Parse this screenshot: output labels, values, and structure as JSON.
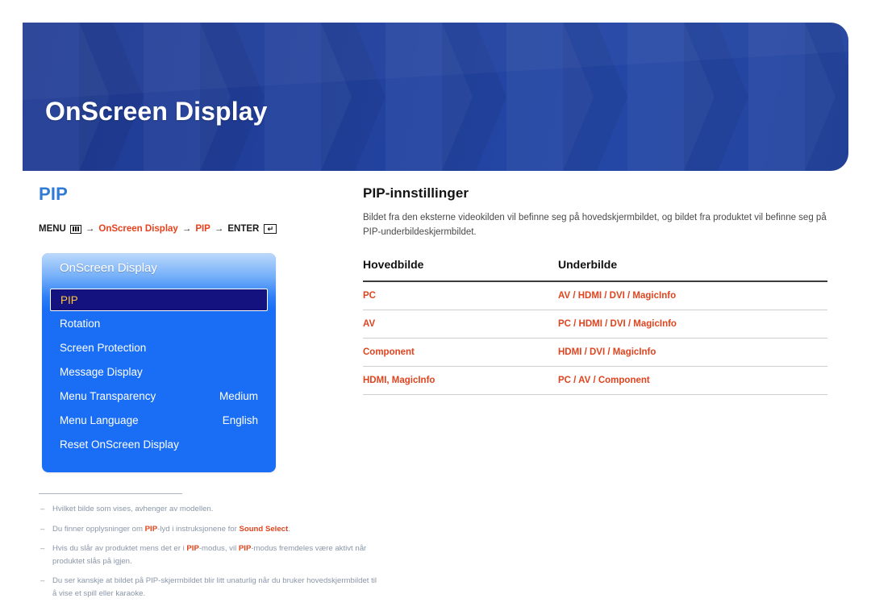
{
  "header": {
    "title": "OnScreen Display",
    "accent_color": "#21409c"
  },
  "left": {
    "section_title": "PIP",
    "breadcrumb": {
      "menu_label": "MENU",
      "menu_icon": "menu-grid-icon",
      "arrow": "→",
      "step1": "OnScreen Display",
      "step2": "PIP",
      "enter_label": "ENTER",
      "enter_icon": "enter-return-icon",
      "enter_glyph": "↵"
    },
    "osd": {
      "panel_title": "OnScreen Display",
      "items": [
        {
          "label": "PIP",
          "value": "",
          "selected": true
        },
        {
          "label": "Rotation",
          "value": "",
          "selected": false
        },
        {
          "label": "Screen Protection",
          "value": "",
          "selected": false
        },
        {
          "label": "Message Display",
          "value": "",
          "selected": false
        },
        {
          "label": "Menu Transparency",
          "value": "Medium",
          "selected": false
        },
        {
          "label": "Menu Language",
          "value": "English",
          "selected": false
        },
        {
          "label": "Reset OnScreen Display",
          "value": "",
          "selected": false
        }
      ],
      "highlight_color": "#ffc742",
      "panel_color": "#1a6ef5"
    }
  },
  "right": {
    "title": "PIP-innstillinger",
    "description": "Bildet fra den eksterne videokilden vil befinne seg på hovedskjermbildet, og bildet fra produktet vil befinne seg på PIP-underbildeskjermbildet.",
    "table": {
      "headers": [
        "Hovedbilde",
        "Underbilde"
      ],
      "rows": [
        [
          "PC",
          "AV / HDMI / DVI / MagicInfo"
        ],
        [
          "AV",
          "PC / HDMI / DVI / MagicInfo"
        ],
        [
          "Component",
          "HDMI / DVI / MagicInfo"
        ],
        [
          "HDMI, MagicInfo",
          "PC / AV / Component"
        ]
      ],
      "value_color": "#e0441f"
    }
  },
  "notes": [
    {
      "parts": [
        {
          "t": "Hvilket bilde som vises, avhenger av modellen.",
          "b": false
        }
      ]
    },
    {
      "parts": [
        {
          "t": "Du finner opplysninger om ",
          "b": false
        },
        {
          "t": "PIP",
          "b": true
        },
        {
          "t": "-lyd i instruksjonene for ",
          "b": false
        },
        {
          "t": "Sound Select",
          "b": true
        },
        {
          "t": ".",
          "b": false
        }
      ]
    },
    {
      "parts": [
        {
          "t": "Hvis du slår av produktet mens det er i ",
          "b": false
        },
        {
          "t": "PIP",
          "b": true
        },
        {
          "t": "-modus, vil ",
          "b": false
        },
        {
          "t": "PIP",
          "b": true
        },
        {
          "t": "-modus fremdeles være aktivt når produktet slås på igjen.",
          "b": false
        }
      ]
    },
    {
      "parts": [
        {
          "t": "Du ser kanskje at bildet på PIP-skjermbildet blir litt unaturlig når du bruker hovedskjermbildet til å vise et spill eller karaoke.",
          "b": false
        }
      ]
    }
  ]
}
